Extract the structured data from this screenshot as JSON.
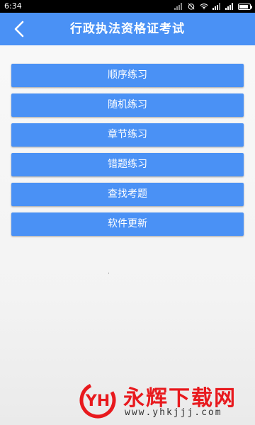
{
  "status_bar": {
    "time": "6:34",
    "icons": [
      "signal-bars-icon",
      "alarm-clock-icon",
      "wifi-icon",
      "signal-bars-icon",
      "signal-bars-icon",
      "battery-icon"
    ]
  },
  "header": {
    "title": "行政执法资格证考试",
    "back_icon": "chevron-left-icon",
    "background_color": "#4a91f5"
  },
  "menu": {
    "items": [
      {
        "label": "顺序练习"
      },
      {
        "label": "随机练习"
      },
      {
        "label": "章节练习"
      },
      {
        "label": "错题练习"
      },
      {
        "label": "查找考题"
      },
      {
        "label": "软件更新"
      }
    ],
    "button_color": "#4a91f5"
  },
  "watermark": {
    "logo_text": "YH",
    "brand": "永辉下载网",
    "url": "www.yhkjjj.com",
    "color": "#e8191d"
  }
}
